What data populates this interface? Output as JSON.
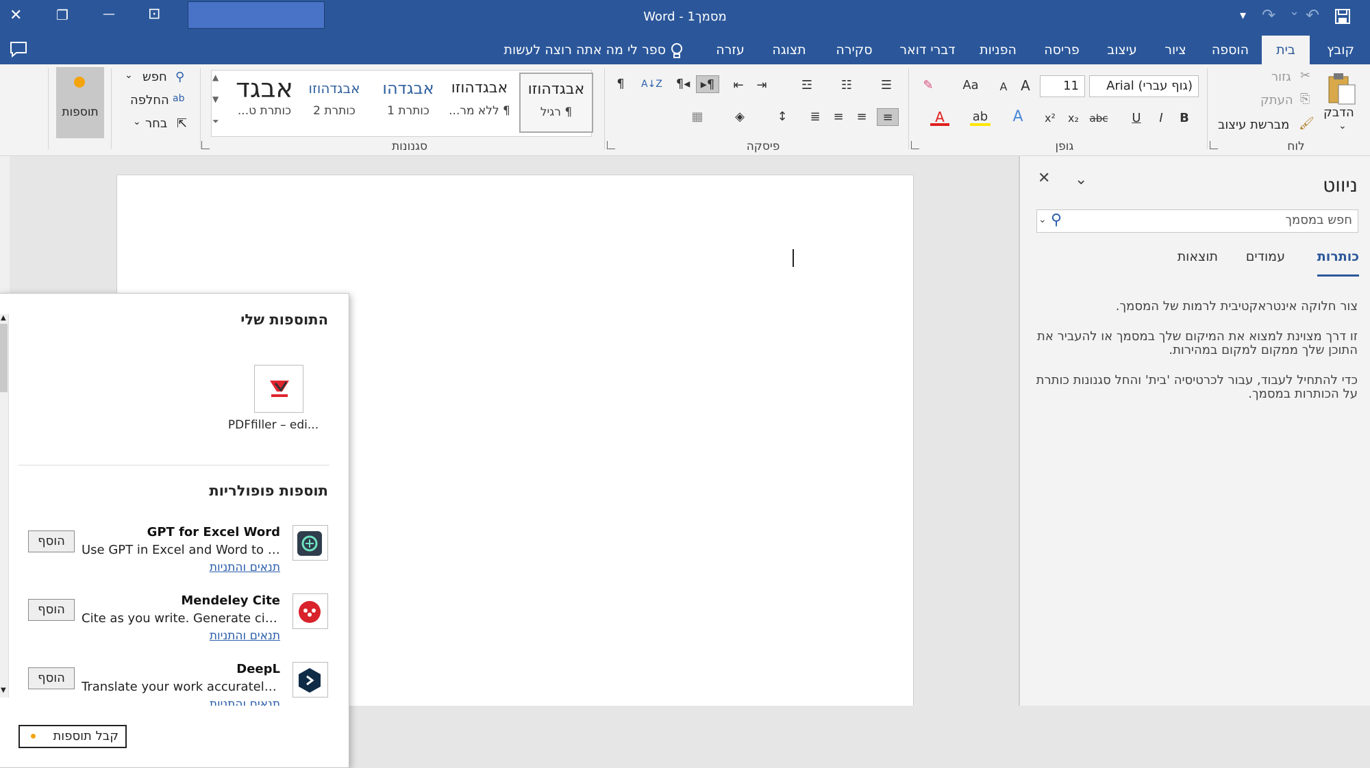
{
  "titlebar": {
    "title": "מסמך1  -  Word",
    "close": "✕",
    "restore": "❐",
    "minimize": "—",
    "ribbon_display": "⊡",
    "customize": "▾",
    "redo": "↷",
    "undo_arrow": "⌄",
    "undo": "↶",
    "save_icon": "save-icon"
  },
  "tabs": [
    {
      "label": "קובץ"
    },
    {
      "label": "בית"
    },
    {
      "label": "הוספה"
    },
    {
      "label": "ציור"
    },
    {
      "label": "עיצוב"
    },
    {
      "label": "פריסה"
    },
    {
      "label": "הפניות"
    },
    {
      "label": "דברי דואר"
    },
    {
      "label": "סקירה"
    },
    {
      "label": "תצוגה"
    },
    {
      "label": "עזרה"
    }
  ],
  "tellme": "ספר לי מה אתה רוצה לעשות",
  "ribbon": {
    "clipboard": {
      "group": "לוח",
      "paste": "הדבק",
      "cut": "גזור",
      "copy": "העתק",
      "format_painter": "מברשת עיצוב"
    },
    "font": {
      "group": "גופן",
      "font_name": "(גוף עברי) Arial",
      "font_size": "11",
      "grow": "A",
      "shrink": "A",
      "case": "Aa",
      "bold": "B",
      "italic": "I",
      "underline": "U",
      "strike": "abc",
      "subscript": "x₂",
      "superscript": "x²",
      "text_effects": "A",
      "highlight": "ab",
      "font_color": "A"
    },
    "paragraph": {
      "group": "פיסקה",
      "pilcrow": "¶",
      "sort": "A↓Z",
      "ltr": "¶◂",
      "rtl": "▸¶"
    },
    "styles": {
      "group": "סגנונות",
      "items": [
        {
          "sample": "אבגדהוזו",
          "name": "¶ רגיל"
        },
        {
          "sample": "אבגדהוזו",
          "name": "¶ ללא מר..."
        },
        {
          "sample": "אבגדהו",
          "name": "כותרת 1"
        },
        {
          "sample": "אבגדהוזו",
          "name": "כותרת 2"
        },
        {
          "sample": "אבגד",
          "name": "כותרת ט..."
        }
      ]
    },
    "editing": {
      "find": "חפש",
      "replace": "החלפה",
      "select": "בחר"
    },
    "addins_button": "תוספות"
  },
  "navpane": {
    "title": "ניווט",
    "search_placeholder": "חפש במסמך",
    "tabs": [
      "כותרות",
      "עמודים",
      "תוצאות"
    ],
    "text1": "צור חלוקה אינטראקטיבית לרמות של המסמך.",
    "text2": "זו דרך מצוינת למצוא את המיקום שלך במסמך או להעביר את התוכן שלך ממקום למקום במהירות.",
    "text3": "כדי להתחיל לעבוד, עבור לכרטיסיה 'בית' והחל סגנונות כותרת על הכותרות במסמך."
  },
  "addins": {
    "my_title": "התוספות שלי",
    "my_addin": "PDFfiller – edi...",
    "popular_title": "תוספות פופולריות",
    "items": [
      {
        "name": "GPT for Excel Word",
        "desc": "Use GPT in Excel and Word to e...",
        "terms": "תנאים והתניות",
        "add": "הוסף"
      },
      {
        "name": "Mendeley Cite",
        "desc": "Cite as you write. Generate citati...",
        "terms": "תנאים והתניות",
        "add": "הוסף"
      },
      {
        "name": "DeepL",
        "desc": "Translate your work accurately a...",
        "terms": "תנאים והתניות",
        "add": "הוסף"
      }
    ],
    "get_addins": "קבל תוספות"
  },
  "colors": {
    "brand": "#2b579a",
    "accent_orange": "#f4a30b",
    "link": "#2b5eab"
  }
}
